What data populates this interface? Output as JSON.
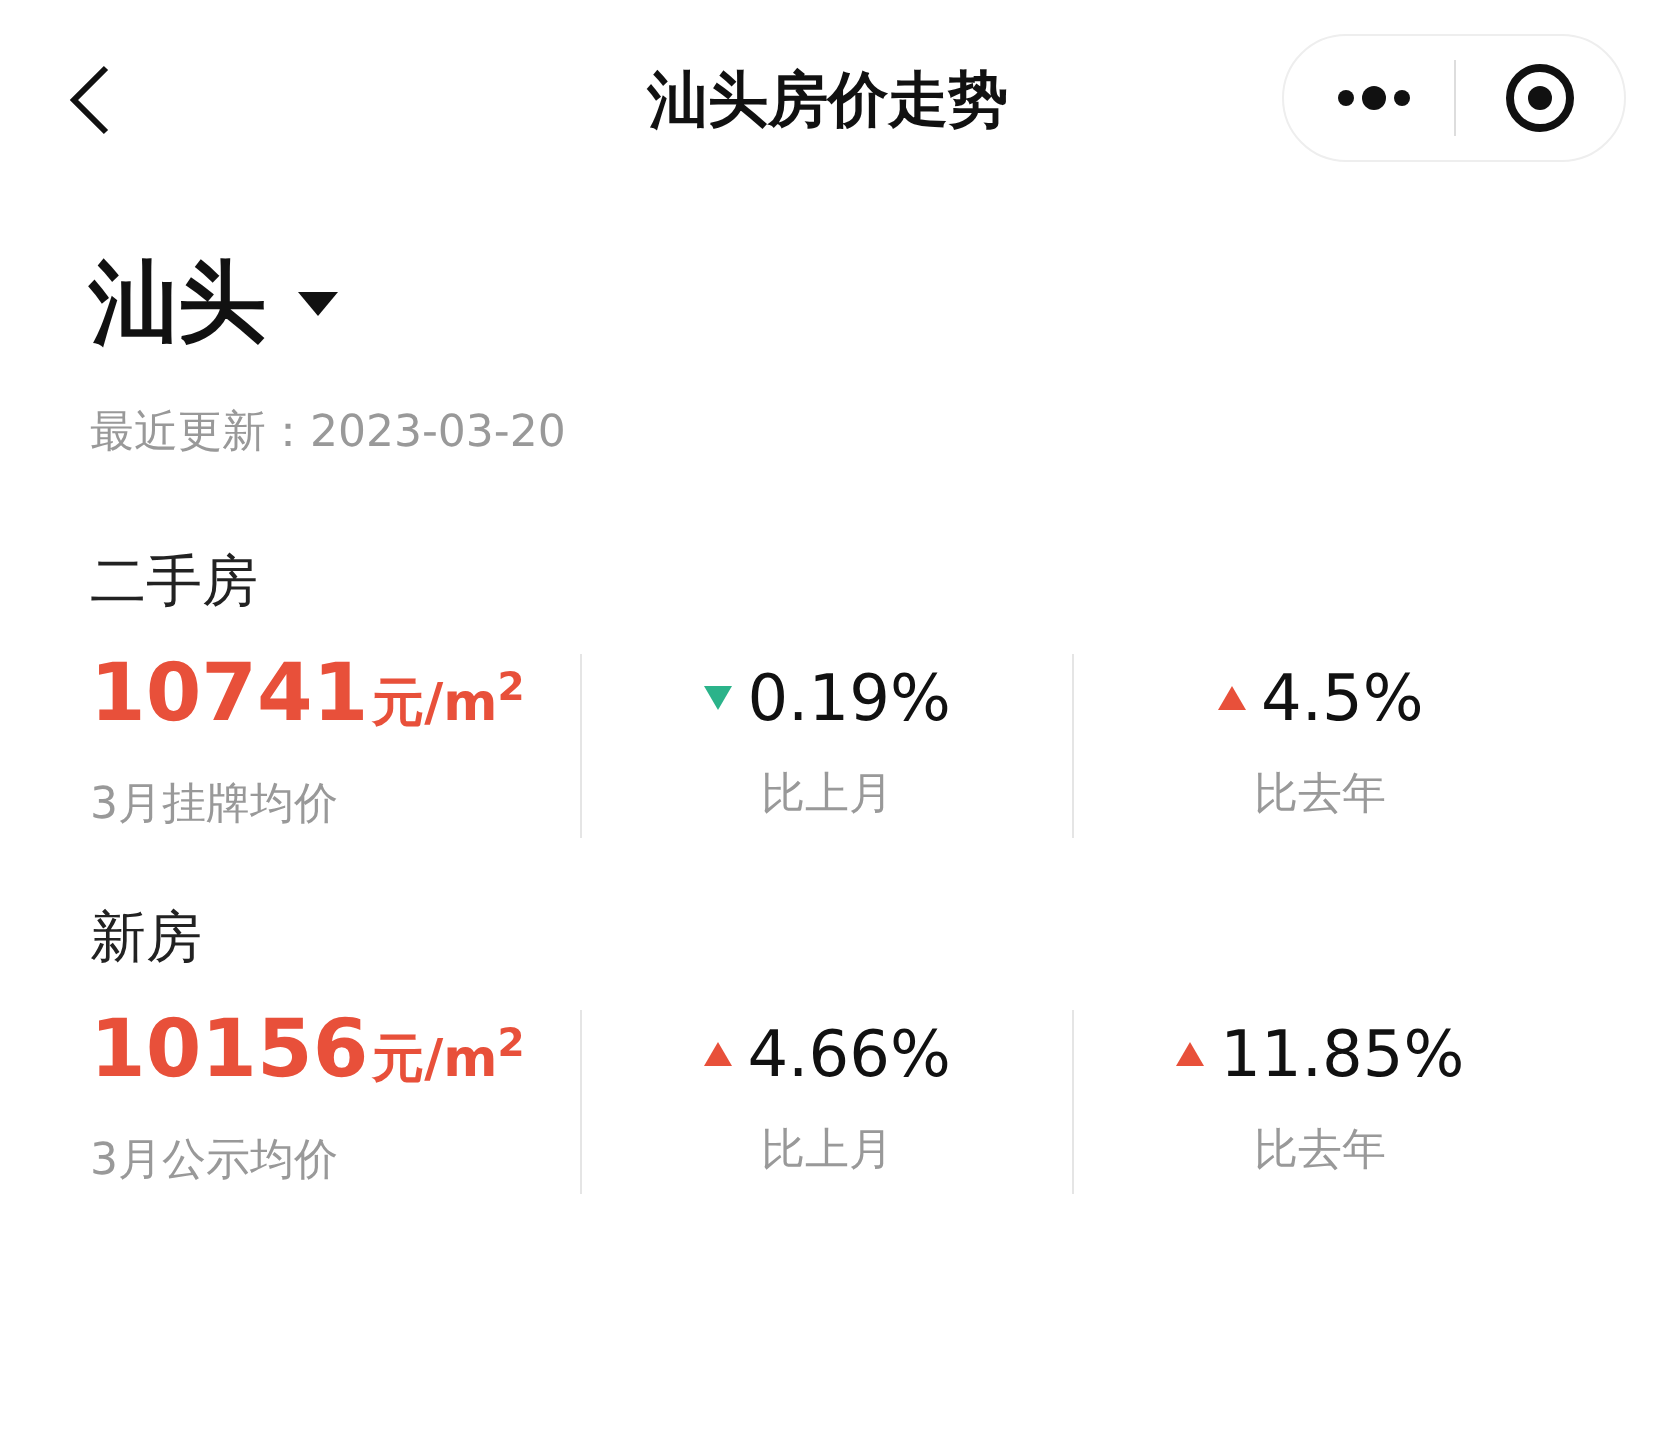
{
  "nav": {
    "title": "汕头房价走势"
  },
  "city": "汕头",
  "updated": "最近更新：2023-03-20",
  "sections": [
    {
      "title": "二手房",
      "price": "10741",
      "unit": "元/m$^{2}$",
      "price_label": "3月挂牌均价",
      "changes": [
        {
          "increase": false,
          "value": "0.19%",
          "label": "比上月"
        },
        {
          "increase": true,
          "value": "4.5%",
          "label": "比去年"
        }
      ]
    },
    {
      "title": "新房",
      "price": "10156",
      "unit": "元/m$^{2}$",
      "price_label": "3月公示均价",
      "changes": [
        {
          "increase": true,
          "value": "4.66%",
          "label": "比上月"
        },
        {
          "increase": true,
          "value": "11.85%",
          "label": "比去年"
        }
      ]
    }
  ]
}
